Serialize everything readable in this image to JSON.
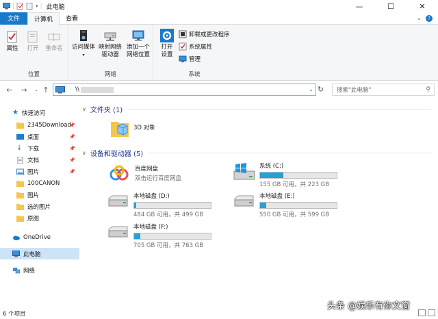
{
  "window": {
    "title": "此电脑",
    "controls": {
      "minimize": "—",
      "maximize": "☐",
      "close": "✕"
    }
  },
  "tabs": {
    "file": "文件",
    "computer": "计算机",
    "view": "查看",
    "expand_icon": "chevron-down-icon",
    "help_icon": "help-icon"
  },
  "ribbon": {
    "location": {
      "label": "位置",
      "properties": "属性",
      "open": "打开",
      "rename": "重命名"
    },
    "network": {
      "label": "网络",
      "access_media": "访问媒体",
      "map_drive_1": "映射网络",
      "map_drive_2": "驱动器",
      "add_location_1": "添加一个",
      "add_location_2": "网络位置"
    },
    "system": {
      "label": "系统",
      "open_settings_1": "打开",
      "open_settings_2": "设置",
      "uninstall": "卸载或更改程序",
      "system_properties": "系统属性",
      "manage": "管理"
    }
  },
  "address": {
    "path": "\\\\",
    "search_placeholder": "搜索\"此电脑\""
  },
  "sidebar": {
    "quick_access": "快速访问",
    "items": [
      {
        "label": "2345Download",
        "pinned": true
      },
      {
        "label": "桌面",
        "pinned": true
      },
      {
        "label": "下载",
        "pinned": true
      },
      {
        "label": "文档",
        "pinned": true
      },
      {
        "label": "图片",
        "pinned": true
      },
      {
        "label": "100CANON",
        "pinned": false
      },
      {
        "label": "图片",
        "pinned": false
      },
      {
        "label": "选的图片",
        "pinned": false
      },
      {
        "label": "原图",
        "pinned": false
      }
    ],
    "onedrive": "OneDrive",
    "this_pc": "此电脑",
    "network": "网络"
  },
  "content": {
    "folders_header": "文件夹 (1)",
    "folders": [
      {
        "name": "3D 对象"
      }
    ],
    "devices_header": "设备和驱动器 (5)",
    "baidu": {
      "name": "百度网盘",
      "sub": "双击运行百度网盘"
    },
    "drives": [
      {
        "name": "系统 (C:)",
        "info": "155 GB 可用，共 223 GB",
        "used_fraction": 0.3
      },
      {
        "name": "本地磁盘 (D:)",
        "info": "484 GB 可用，共 499 GB",
        "used_fraction": 0.03
      },
      {
        "name": "本地磁盘 (E:)",
        "info": "550 GB 可用，共 599 GB",
        "used_fraction": 0.08
      },
      {
        "name": "本地磁盘 (F:)",
        "info": "705 GB 可用，共 763 GB",
        "used_fraction": 0.076
      }
    ]
  },
  "status": {
    "count": "6 个项目"
  },
  "watermark": "头条 @娱乐有你文窗",
  "colors": {
    "accent": "#1979ca",
    "drive_fill": "#26a0da",
    "section_header": "#1e3287",
    "selection": "#cce4f7"
  }
}
